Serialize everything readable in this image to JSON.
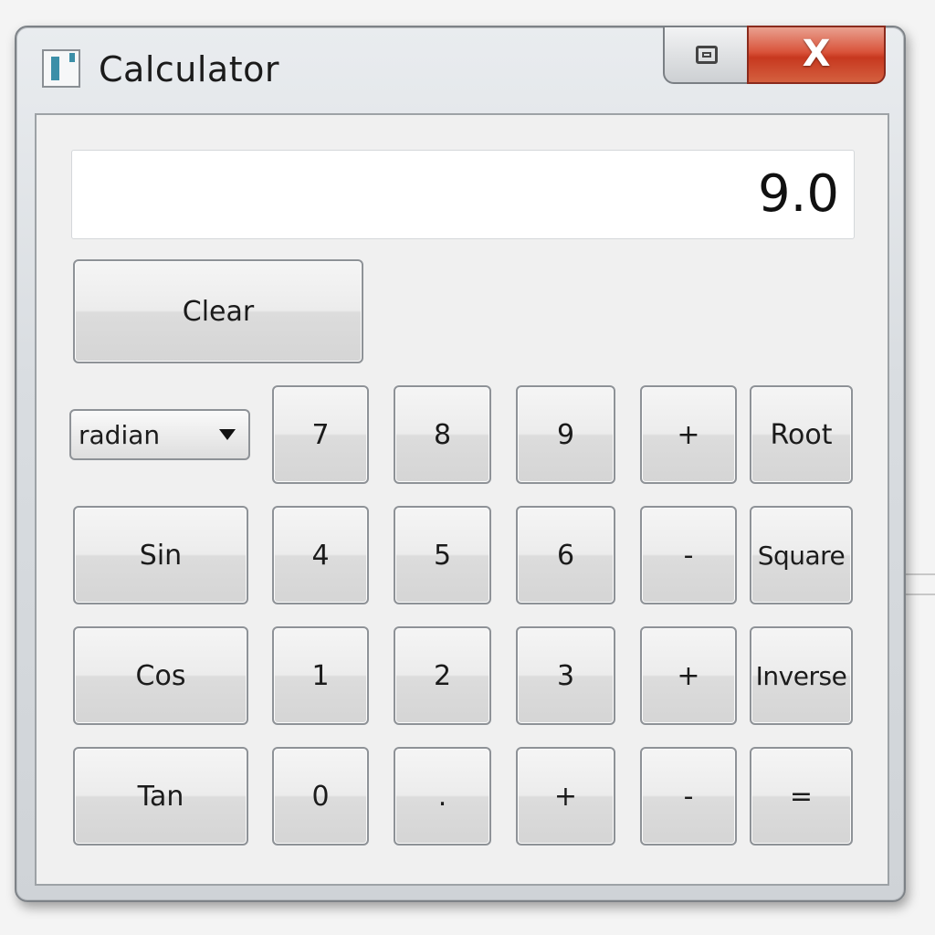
{
  "window": {
    "title": "Calculator"
  },
  "title_controls": {
    "restore_icon": "restore-icon",
    "close_label": "X"
  },
  "display": {
    "value": "9.0"
  },
  "buttons": {
    "clear": "Clear",
    "angle_mode": "radian",
    "row1": [
      "7",
      "8",
      "9",
      "+",
      "Root"
    ],
    "row2": [
      "Sin",
      "4",
      "5",
      "6",
      "-",
      "Square"
    ],
    "row3": [
      "Cos",
      "1",
      "2",
      "3",
      "+",
      "Inverse"
    ],
    "row4": [
      "Tan",
      "0",
      ".",
      "+",
      "-",
      "="
    ]
  },
  "colors": {
    "close_button": "#d9533a",
    "window_frame": "#d9dde1",
    "client_bg": "#f0f0f0"
  }
}
